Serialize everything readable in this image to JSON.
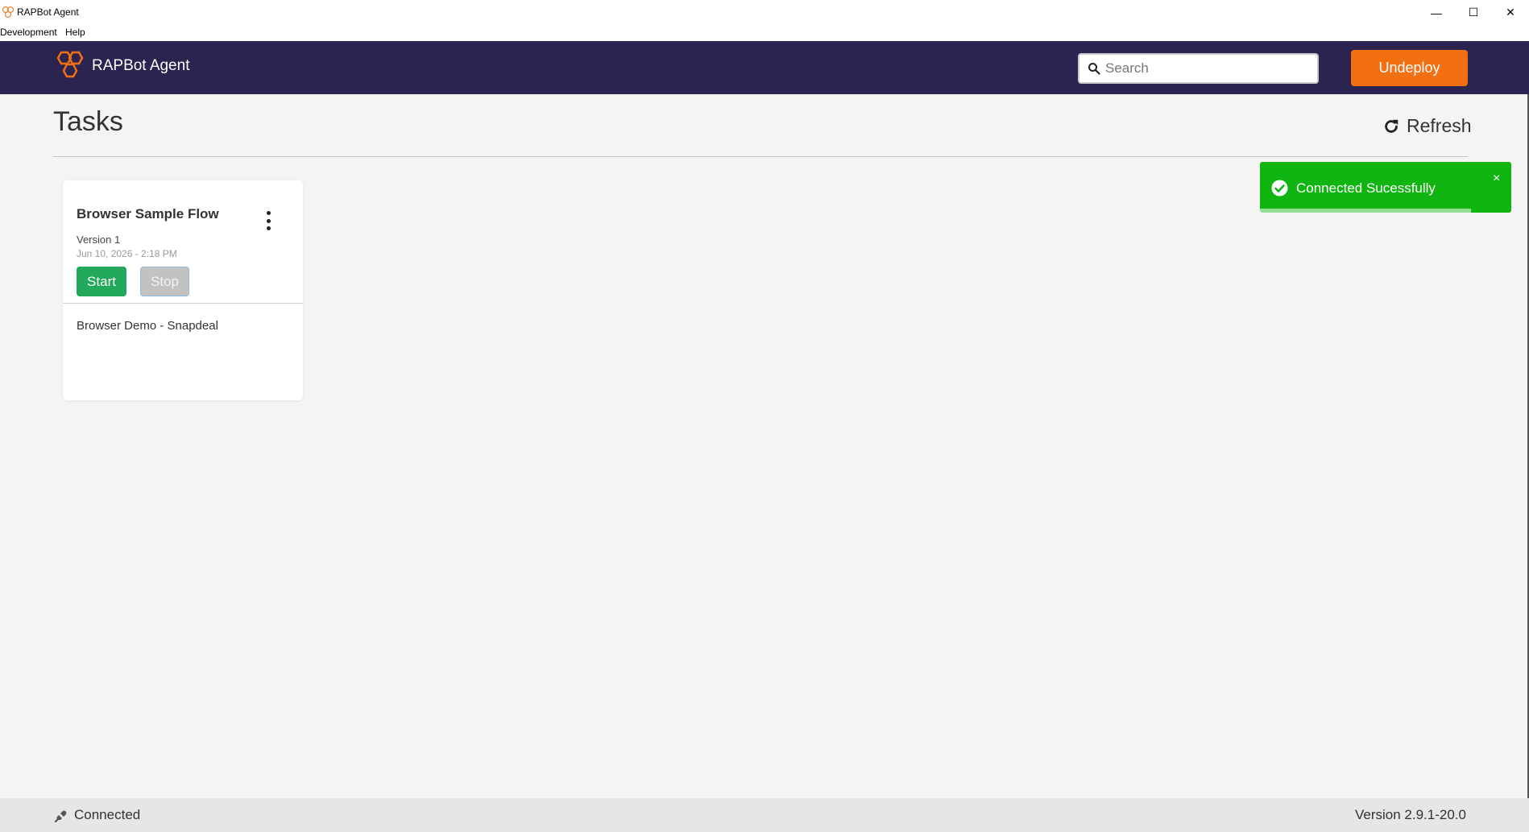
{
  "window": {
    "title": "RAPBot Agent",
    "controls": {
      "minimize": "—",
      "maximize": "☐",
      "close": "✕"
    }
  },
  "menu": {
    "items": [
      "Development",
      "Help"
    ]
  },
  "header": {
    "brand": "RAPBot Agent",
    "search": {
      "placeholder": "Search",
      "value": ""
    },
    "undeploy_label": "Undeploy",
    "colors": {
      "bar": "#2b2350",
      "accent": "#f26f12",
      "logo": "#f26f12"
    }
  },
  "main": {
    "title": "Tasks",
    "refresh_label": "Refresh",
    "tasks": [
      {
        "name": "Browser Sample Flow",
        "version": "Version 1",
        "date": "Jun 10, 2026 - 2:18 PM",
        "start_label": "Start",
        "stop_label": "Stop",
        "description": "Browser Demo - Snapdeal"
      }
    ]
  },
  "toast": {
    "message": "Connected Sucessfully",
    "close": "×",
    "progress": 0.84,
    "color": "#11b511"
  },
  "footer": {
    "status": "Connected",
    "version": "Version 2.9.1-20.0"
  }
}
